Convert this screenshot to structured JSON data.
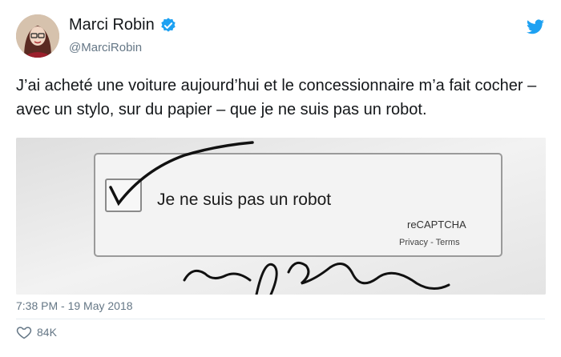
{
  "author": {
    "name": "Marci Robin",
    "handle": "@MarciRobin"
  },
  "tweet": {
    "text": "J’ai acheté une voiture aujourd’hui et le concessionnaire m’a fait cocher – avec un stylo, sur du papier – que je ne suis pas un robot.",
    "timestamp": "7:38 PM - 19 May 2018",
    "likes": "84K"
  },
  "media": {
    "captcha_label": "Je ne suis pas un robot",
    "brand": "reCAPTCHA",
    "links": "Privacy - Terms"
  },
  "colors": {
    "twitter_blue": "#1da1f2",
    "muted_text": "#657786"
  },
  "icons": [
    "verified-badge-icon",
    "twitter-bird-icon",
    "heart-icon"
  ]
}
